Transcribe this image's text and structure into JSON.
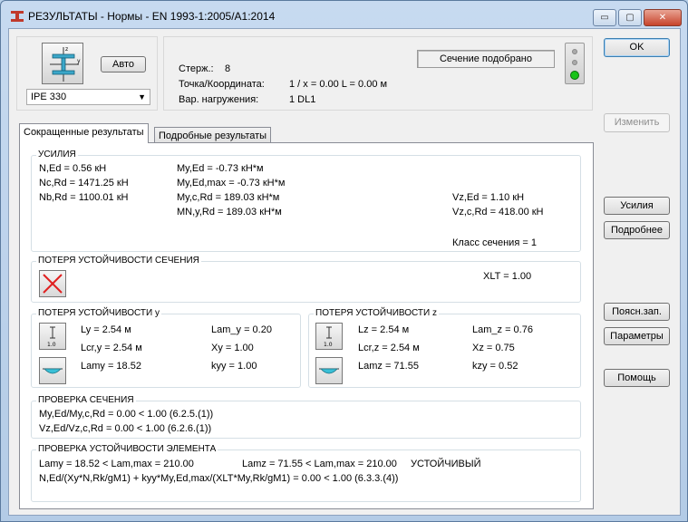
{
  "window": {
    "title": "РЕЗУЛЬТАТЫ - Нормы - EN 1993-1:2005/A1:2014",
    "min_glyph": "▭",
    "max_glyph": "▢",
    "close_glyph": "✕"
  },
  "section": {
    "profile": "IPE 330",
    "auto_label": "Авто"
  },
  "info": {
    "member_label": "Стерж.:",
    "member_value": "8",
    "point_label": "Точка/Координата:",
    "point_value": "1 / x = 0.00 L = 0.00 м",
    "load_label": "Вар. нагружения:",
    "load_value": "1 DL1"
  },
  "status": {
    "text": "Сечение подобрано",
    "color": "#19c419"
  },
  "right_buttons": {
    "ok": "OK",
    "change": "Изменить",
    "forces": "Усилия",
    "details": "Подробнее",
    "notes": "Поясн.зап.",
    "params": "Параметры",
    "help": "Помощь"
  },
  "tabs": [
    {
      "label": "Сокращенные результаты",
      "active": true
    },
    {
      "label": "Подробные результаты",
      "active": false
    }
  ],
  "forces": {
    "title": "УСИЛИЯ",
    "col1": [
      "N,Ed = 0.56 кН",
      "Nc,Rd = 1471.25 кН",
      "Nb,Rd = 1100.01 кН"
    ],
    "col2": [
      "My,Ed = -0.73 кН*м",
      "My,Ed,max = -0.73 кН*м",
      "My,c,Rd = 189.03 кН*м",
      "MN,y,Rd = 189.03 кН*м"
    ],
    "col3": [
      "Vz,Ed = 1.10 кН",
      "Vz,c,Rd = 418.00 кН"
    ],
    "class": "Класс сечения = 1"
  },
  "lateral": {
    "title": "ПОТЕРЯ УСТОЙЧИВОСТИ СЕЧЕНИЯ",
    "xlt": "XLT = 1.00"
  },
  "buckling_y": {
    "title": "ПОТЕРЯ УСТОЙЧИВОСТИ y",
    "icon_num": "1.0",
    "left": [
      "Ly = 2.54 м",
      "Lcr,y = 2.54 м",
      "Lamy = 18.52"
    ],
    "right": [
      "Lam_y = 0.20",
      "Xy = 1.00",
      "kyy = 1.00"
    ]
  },
  "buckling_z": {
    "title": "ПОТЕРЯ УСТОЙЧИВОСТИ z",
    "icon_num": "1.0",
    "left": [
      "Lz = 2.54 м",
      "Lcr,z = 2.54 м",
      "Lamz = 71.55"
    ],
    "right": [
      "Lam_z = 0.76",
      "Xz = 0.75",
      "kzy = 0.52"
    ]
  },
  "section_check": {
    "title": "ПРОВЕРКА СЕЧЕНИЯ",
    "line1": "My,Ed/My,c,Rd = 0.00 < 1.00   (6.2.5.(1))",
    "line2": "Vz,Ed/Vz,c,Rd = 0.00 < 1.00   (6.2.6.(1))"
  },
  "member_check": {
    "title": "ПРОВЕРКА УСТОЙЧИВОСТИ ЭЛЕМЕНТА",
    "lamy": "Lamy = 18.52 < Lam,max = 210.00",
    "lamz": "Lamz = 71.55 < Lam,max = 210.00",
    "verdict": "УСТОЙЧИВЫЙ",
    "formula": "N,Ed/(Xy*N,Rk/gM1) + kyy*My,Ed,max/(XLT*My,Rk/gM1) = 0.00 < 1.00   (6.3.3.(4))"
  }
}
